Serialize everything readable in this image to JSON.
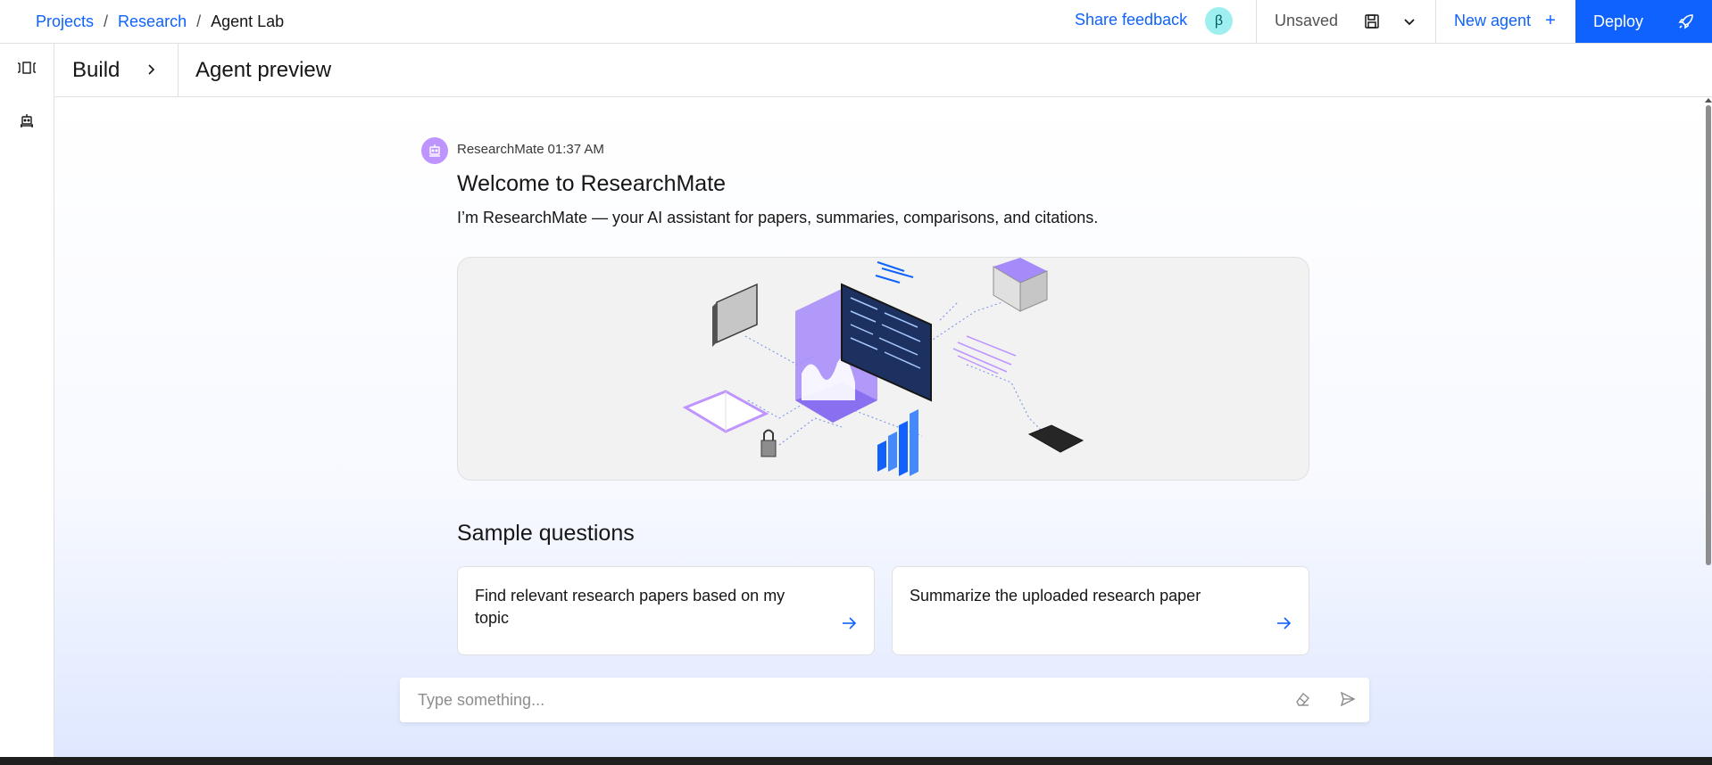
{
  "header": {
    "breadcrumbs": [
      {
        "label": "Projects"
      },
      {
        "label": "Research"
      },
      {
        "label": "Agent Lab"
      }
    ],
    "separator": "/",
    "share_feedback": "Share feedback",
    "beta_badge": "β",
    "status": "Unsaved",
    "new_agent": "New agent",
    "new_agent_plus": "+",
    "deploy": "Deploy"
  },
  "subheader": {
    "build": "Build",
    "preview_title": "Agent preview"
  },
  "message": {
    "sender": "ResearchMate",
    "time": "01:37 AM",
    "title": "Welcome to ResearchMate",
    "body": "I’m ResearchMate — your AI assistant for papers, summaries, comparisons, and citations."
  },
  "sample_questions": {
    "title": "Sample questions",
    "items": [
      {
        "label": "Find relevant research papers based on my topic"
      },
      {
        "label": "Summarize the uploaded research paper"
      }
    ]
  },
  "composer": {
    "placeholder": "Type something..."
  },
  "colors": {
    "accent": "#0f62fe",
    "avatar": "#be95ff",
    "beta": "#9ef0f0"
  },
  "icons": {
    "rail": [
      "sidebar-toggle-icon",
      "agent-icon"
    ],
    "header": [
      "save-icon",
      "chevron-down-icon",
      "rocket-icon"
    ],
    "composer": [
      "eraser-icon",
      "send-icon"
    ]
  }
}
